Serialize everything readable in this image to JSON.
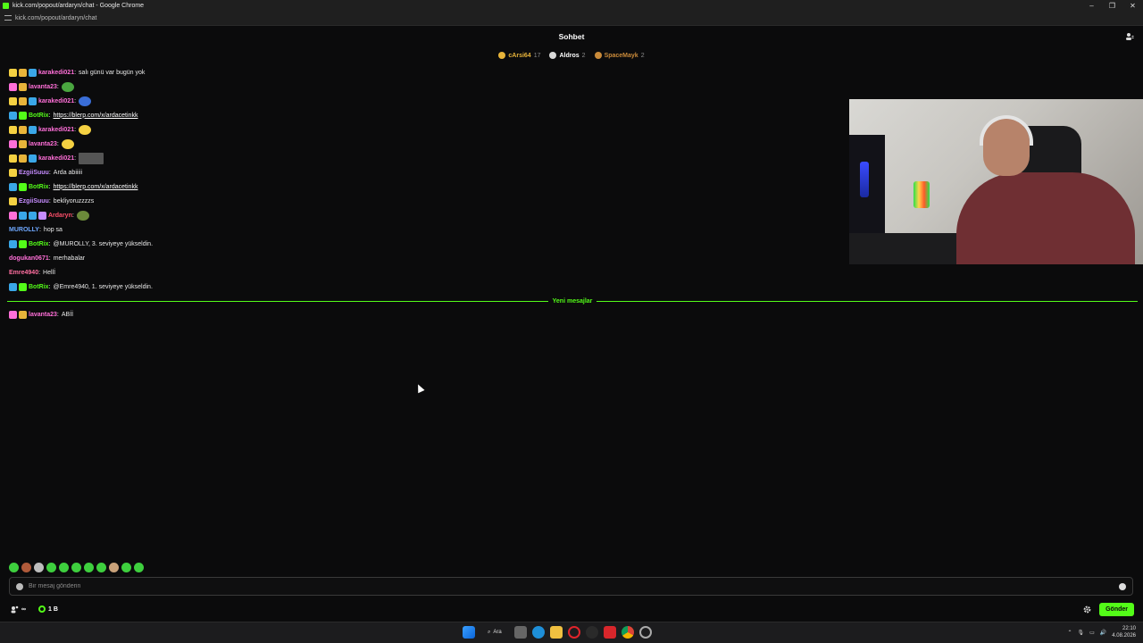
{
  "window": {
    "title": "kick.com/popout/ardaryn/chat - Google Chrome",
    "url": "kick.com/popout/ardaryn/chat"
  },
  "chat": {
    "header": "Sohbet",
    "new_messages_label": "Yeni mesajlar",
    "input_placeholder": "Bir mesaj gönderin",
    "send_label": "Gönder",
    "viewer_count": "∞",
    "points": "1 B"
  },
  "leaderboard": [
    {
      "name": "cArsi64",
      "count": "17",
      "color": "#e8b43a"
    },
    {
      "name": "Aldros",
      "count": "2",
      "color": "#d9d9d9"
    },
    {
      "name": "SpaceMayk",
      "count": "2",
      "color": "#c98a3a"
    }
  ],
  "messages": [
    {
      "user": "karakedi021",
      "user_color": "#ff6fd8",
      "text": "salı günü var bugün yok",
      "badges": [
        "#f5d142",
        "#e8b43a",
        "#3aa7e8"
      ],
      "emote": null,
      "link": false
    },
    {
      "user": "lavanta23",
      "user_color": "#ff6fd8",
      "text": "",
      "badges": [
        "#ff6fd8",
        "#e8b43a"
      ],
      "emote": "#4aa640",
      "link": false
    },
    {
      "user": "karakedi021",
      "user_color": "#ff6fd8",
      "text": "",
      "badges": [
        "#f5d142",
        "#e8b43a",
        "#3aa7e8"
      ],
      "emote": "#3a6ed8",
      "link": false
    },
    {
      "user": "BotRix",
      "user_color": "#53fc18",
      "text": "https://blerp.com/x/ardacetinkk",
      "badges": [
        "#3aa7e8",
        "#53fc18"
      ],
      "emote": null,
      "link": true
    },
    {
      "user": "karakedi021",
      "user_color": "#ff6fd8",
      "text": "",
      "badges": [
        "#f5d142",
        "#e8b43a",
        "#3aa7e8"
      ],
      "emote": "#f5d142",
      "link": false
    },
    {
      "user": "lavanta23",
      "user_color": "#ff6fd8",
      "text": "",
      "badges": [
        "#ff6fd8",
        "#e8b43a"
      ],
      "emote": "#f5d142",
      "link": false
    },
    {
      "user": "karakedi021",
      "user_color": "#ff6fd8",
      "text": "",
      "badges": [
        "#f5d142",
        "#e8b43a",
        "#3aa7e8"
      ],
      "emote": "#555555",
      "link": false
    },
    {
      "user": "EzgiiSuuu",
      "user_color": "#c68cff",
      "text": "Arda abiiiii",
      "badges": [
        "#f5d142"
      ],
      "emote": null,
      "link": false
    },
    {
      "user": "BotRix",
      "user_color": "#53fc18",
      "text": "https://blerp.com/x/ardacetinkk",
      "badges": [
        "#3aa7e8",
        "#53fc18"
      ],
      "emote": null,
      "link": true
    },
    {
      "user": "EzgiiSuuu",
      "user_color": "#c68cff",
      "text": "bekliyoruzzzzs",
      "badges": [
        "#f5d142"
      ],
      "emote": null,
      "link": false
    },
    {
      "user": "Ardaryn",
      "user_color": "#ff4f6a",
      "text": "",
      "badges": [
        "#ff6fd8",
        "#3aa7e8",
        "#3aa7e8",
        "#c68cff"
      ],
      "emote": "#6b8a3a",
      "link": false
    },
    {
      "user": "MUROLLY",
      "user_color": "#6fa8ff",
      "text": "hop sa",
      "badges": [],
      "emote": null,
      "link": false
    },
    {
      "user": "BotRix",
      "user_color": "#53fc18",
      "text": "@MUROLLY, 3. seviyeye yükseldin.",
      "badges": [
        "#3aa7e8",
        "#53fc18"
      ],
      "emote": null,
      "link": false
    },
    {
      "user": "dogukan0671",
      "user_color": "#ff6fd8",
      "text": "merhabalar",
      "badges": [],
      "emote": null,
      "link": false
    },
    {
      "user": "Emre4940",
      "user_color": "#ff6fa0",
      "text": "Hellİ",
      "badges": [],
      "emote": null,
      "link": false
    },
    {
      "user": "BotRix",
      "user_color": "#53fc18",
      "text": "@Emre4940, 1. seviyeye yükseldin.",
      "badges": [
        "#3aa7e8",
        "#53fc18"
      ],
      "emote": null,
      "link": false
    }
  ],
  "new_messages": [
    {
      "user": "lavanta23",
      "user_color": "#ff6fd8",
      "text": "ABİİ",
      "badges": [
        "#ff6fd8",
        "#e8b43a"
      ],
      "emote": null,
      "link": false
    }
  ],
  "taskbar": {
    "search_label": "Ara",
    "time": "22:10",
    "date": "4.08.2026"
  }
}
